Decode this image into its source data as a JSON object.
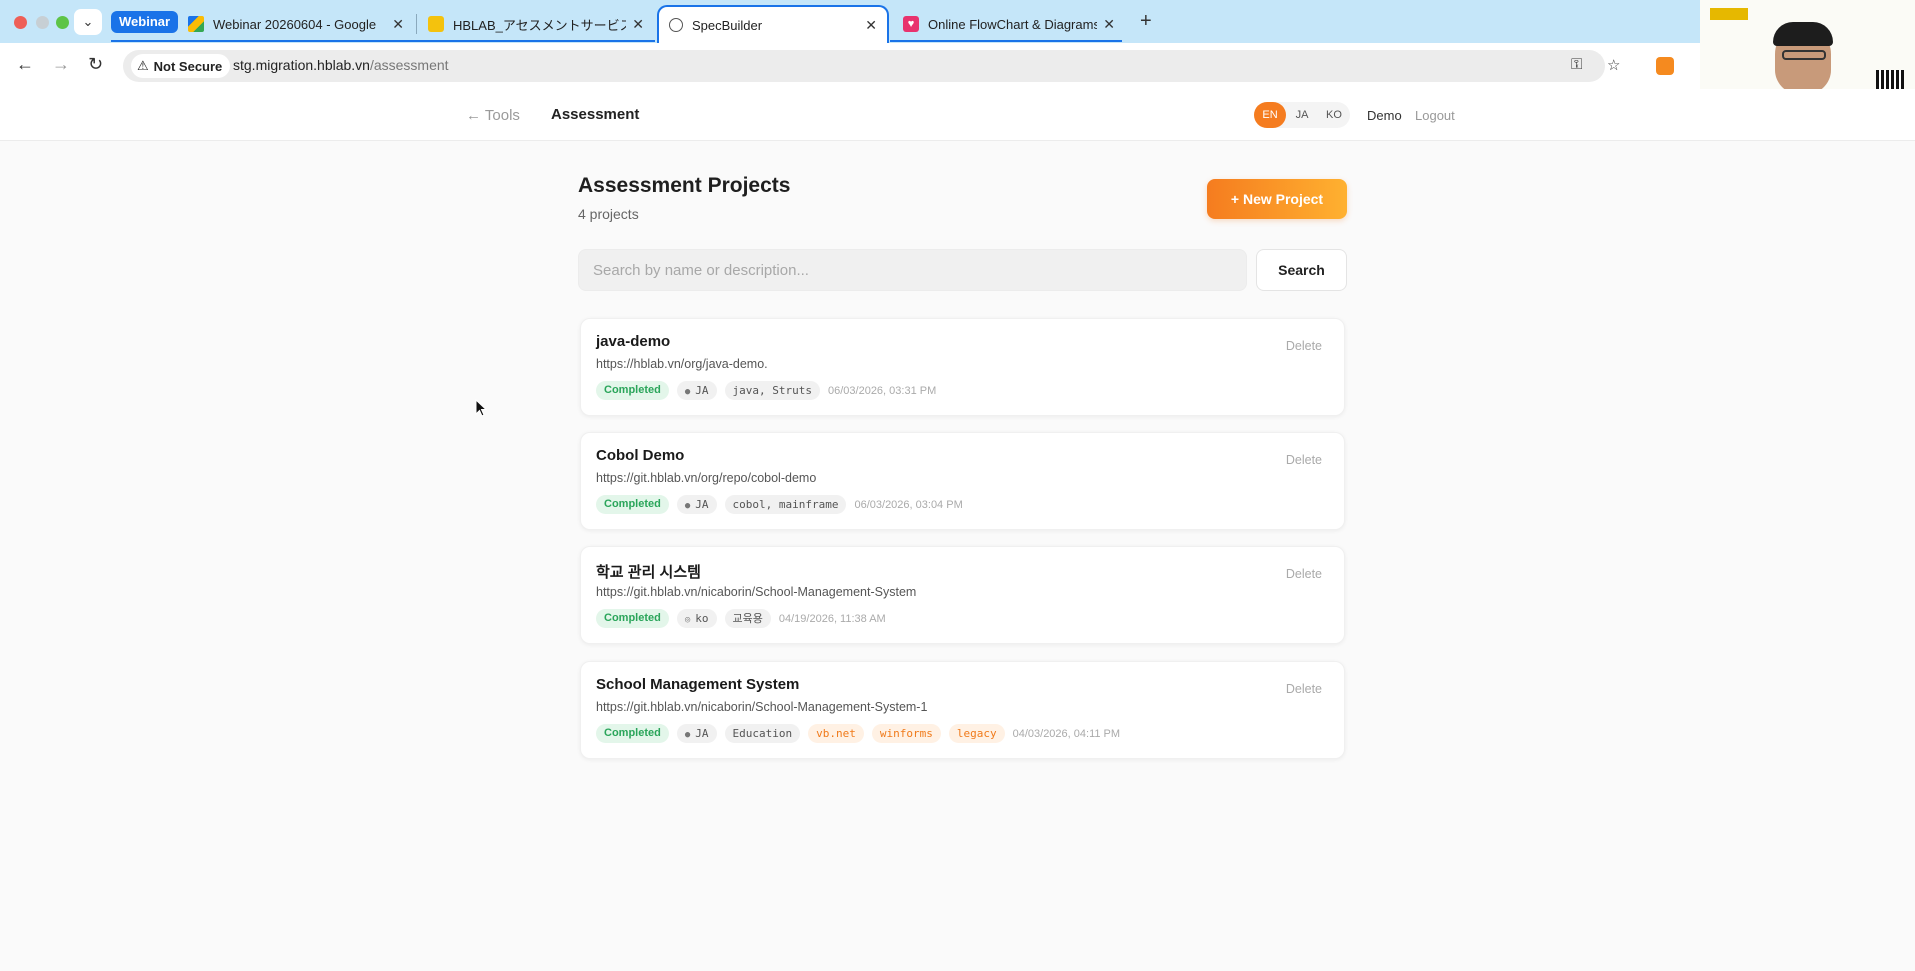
{
  "browser": {
    "tab_group_label": "Webinar",
    "tabs": [
      {
        "label": "Webinar 20260604 - Google",
        "icon": "google-drive-icon"
      },
      {
        "label": "HBLAB_アセスメントサービス_",
        "icon": "slides-icon"
      },
      {
        "label": "SpecBuilder",
        "icon": "globe-icon",
        "active": true
      },
      {
        "label": "Online FlowChart & Diagrams",
        "icon": "diagram-app-icon"
      }
    ],
    "security_label": "Not Secure",
    "url_host": "stg.migration.hblab.vn",
    "url_path": "/assessment"
  },
  "header": {
    "back_label": "← Tools",
    "page_label": "Assessment",
    "languages": [
      "EN",
      "JA",
      "KO"
    ],
    "active_language": "EN",
    "user": "Demo",
    "logout": "Logout"
  },
  "main": {
    "title": "Assessment Projects",
    "count": "4 projects",
    "new_project_label": "+ New Project",
    "search_placeholder": "Search by name or description...",
    "search_button": "Search",
    "delete_label": "Delete"
  },
  "projects": [
    {
      "name": "java-demo",
      "url": "https://hblab.vn/org/java-demo.",
      "status": "Completed",
      "language": "JA",
      "tags": [
        "java, Struts"
      ],
      "date": "06/03/2026, 03:31 PM"
    },
    {
      "name": "Cobol Demo",
      "url": "https://git.hblab.vn/org/repo/cobol-demo",
      "status": "Completed",
      "language": "JA",
      "tags": [
        "cobol, mainframe"
      ],
      "date": "06/03/2026, 03:04 PM"
    },
    {
      "name": "학교 관리 시스템",
      "url": "https://git.hblab.vn/nicaborin/School-Management-System",
      "status": "Completed",
      "language": "ko",
      "tags": [
        "교육용"
      ],
      "date": "04/19/2026, 11:38 AM"
    },
    {
      "name": "School Management System",
      "url": "https://git.hblab.vn/nicaborin/School-Management-System-1",
      "status": "Completed",
      "language": "JA",
      "tags": [
        "Education"
      ],
      "tech_tags": [
        "vb.net",
        "winforms",
        "legacy"
      ],
      "date": "04/03/2026, 04:11 PM"
    }
  ],
  "colors": {
    "accent": "#f57c1f",
    "status_completed": "#2aa55a",
    "tab_active_border": "#1a73e8"
  }
}
